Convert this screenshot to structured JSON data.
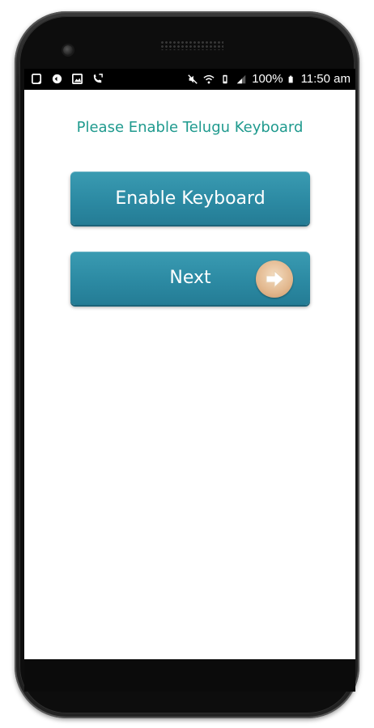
{
  "status_bar": {
    "battery_percent": "100%",
    "time": "11:50 am",
    "left_icons": [
      "screen-icon",
      "notification-icon",
      "image-icon",
      "call-icon"
    ],
    "right_icons": [
      "mute-icon",
      "wifi-icon",
      "vibrate-icon",
      "signal-icon",
      "battery-icon"
    ]
  },
  "main": {
    "title": "Please Enable Telugu Keyboard",
    "enable_button_label": "Enable Keyboard",
    "next_button_label": "Next",
    "next_icon": "arrow-right-icon"
  },
  "colors": {
    "title": "#1f9a8e",
    "button": "#2c8aa3",
    "arrow_circle": "#e2b78d",
    "status_bar": "#000000"
  }
}
